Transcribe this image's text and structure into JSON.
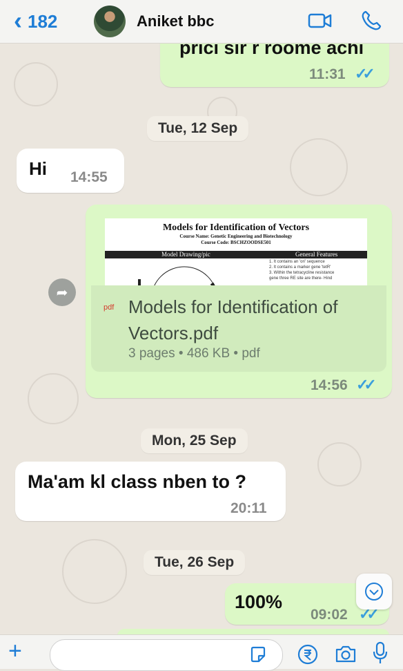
{
  "header": {
    "back_count": "182",
    "contact_name": "Aniket bbc"
  },
  "messages": {
    "m1": {
      "text": "prici sir r roome achi",
      "time": "11:31",
      "ticks": "✓✓"
    },
    "date1": "Tue, 12 Sep",
    "m2": {
      "text": "Hi",
      "time": "14:55"
    },
    "m3": {
      "doc_title": "Models for Identification of Vectors",
      "doc_course": "Course Name: Genetic Engineering and Biotechnology",
      "doc_code": "Course Code: BSCHZOODSE501",
      "col1": "Model Drawing/pic",
      "col2": "General Features",
      "features": [
        "1.  It contains an 'ori' sequence",
        "2.  It contains a marker gene 'tetR'",
        "3.  Within the tetracycline resistance",
        "     gene three RE site are there- Hind"
      ],
      "badge": "pdf",
      "file_name": "Models for Identification of Vectors.pdf",
      "meta": "3 pages • 486 KB • pdf",
      "time": "14:56",
      "ticks": "✓✓"
    },
    "date2": "Mon, 25 Sep",
    "m4": {
      "text": "Ma'am kl class nben to ?",
      "time": "20:11"
    },
    "date3": "Tue, 26 Sep",
    "m5": {
      "text": "100%",
      "time": "09:02",
      "ticks": "✓✓"
    }
  },
  "colors": {
    "accent": "#1e7dd6",
    "outgoing_bubble": "#dcf8c6",
    "incoming_bubble": "#ffffff",
    "read_ticks": "#3b9fdc"
  },
  "icons": [
    "chevron-left-icon",
    "video-call-icon",
    "phone-icon",
    "forward-icon",
    "chevron-down-icon",
    "plus-icon",
    "sticker-icon",
    "rupee-icon",
    "camera-icon",
    "microphone-icon"
  ]
}
